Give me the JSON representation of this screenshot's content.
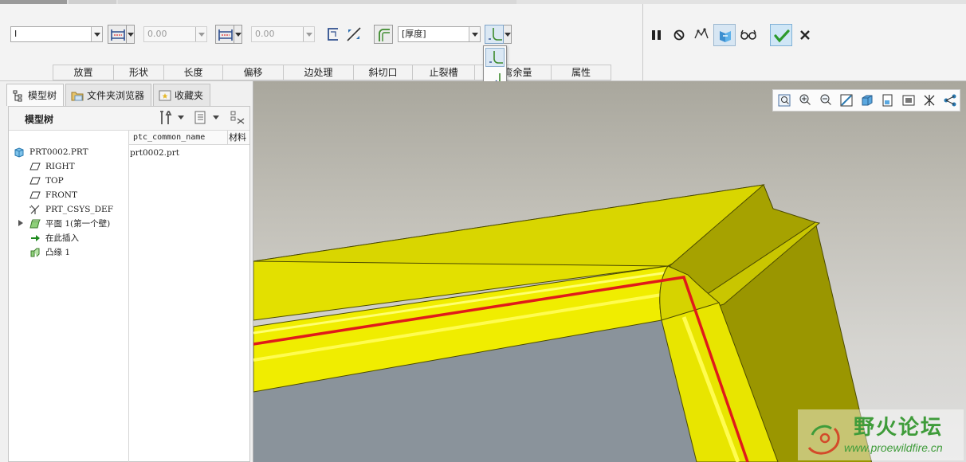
{
  "dashboard": {
    "wall_type_combo": "I",
    "width_value": "0.00",
    "length_value": "0.00",
    "thickness_combo": "[厚度]",
    "tabs": [
      "放置",
      "形状",
      "长度",
      "偏移",
      "边处理",
      "斜切口",
      "止裂槽",
      "折弯余量",
      "属性"
    ],
    "controls": [
      "pause-icon",
      "no-preview-icon",
      "verify-icon",
      "view-feature-icon",
      "glasses-icon",
      "ok-check-icon",
      "cancel-x-icon"
    ]
  },
  "dropdown_menu": {
    "items": [
      "bend-inside-icon",
      "bend-outside-icon",
      "bend-zero-icon"
    ]
  },
  "navigator": {
    "tabs": [
      "模型树",
      "文件夹浏览器",
      "收藏夹"
    ],
    "tree_title": "模型树",
    "columns": [
      "ptc_common_name",
      "材料"
    ],
    "items": [
      {
        "label": "PRT0002.PRT",
        "icon": "part-icon",
        "value": "prt0002.prt"
      },
      {
        "label": "RIGHT",
        "icon": "datum-plane-icon"
      },
      {
        "label": "TOP",
        "icon": "datum-plane-icon"
      },
      {
        "label": "FRONT",
        "icon": "datum-plane-icon"
      },
      {
        "label": "PRT_CSYS_DEF",
        "icon": "csys-icon"
      },
      {
        "label": "平面 1(第一个壁)",
        "icon": "flat-wall-icon"
      },
      {
        "label": "在此插入",
        "icon": "insert-here-arrow-icon"
      },
      {
        "label": "凸缘 1",
        "icon": "flange-icon"
      }
    ]
  },
  "viewport": {
    "view_toolbar": [
      "refit-icon",
      "zoom-in-icon",
      "zoom-out-icon",
      "repaint-icon",
      "display-style-icon",
      "saved-views-icon",
      "view-manager-icon",
      "datum-display-icon",
      "annotation-display-icon"
    ],
    "colors": {
      "sheet": "#e3e000",
      "sheet_shadow": "#9a9600",
      "edge_line": "#e01a1a",
      "background": "#c2c0b8"
    }
  },
  "watermark": {
    "title": "野火论坛",
    "url": "www.proewildfire.cn"
  }
}
